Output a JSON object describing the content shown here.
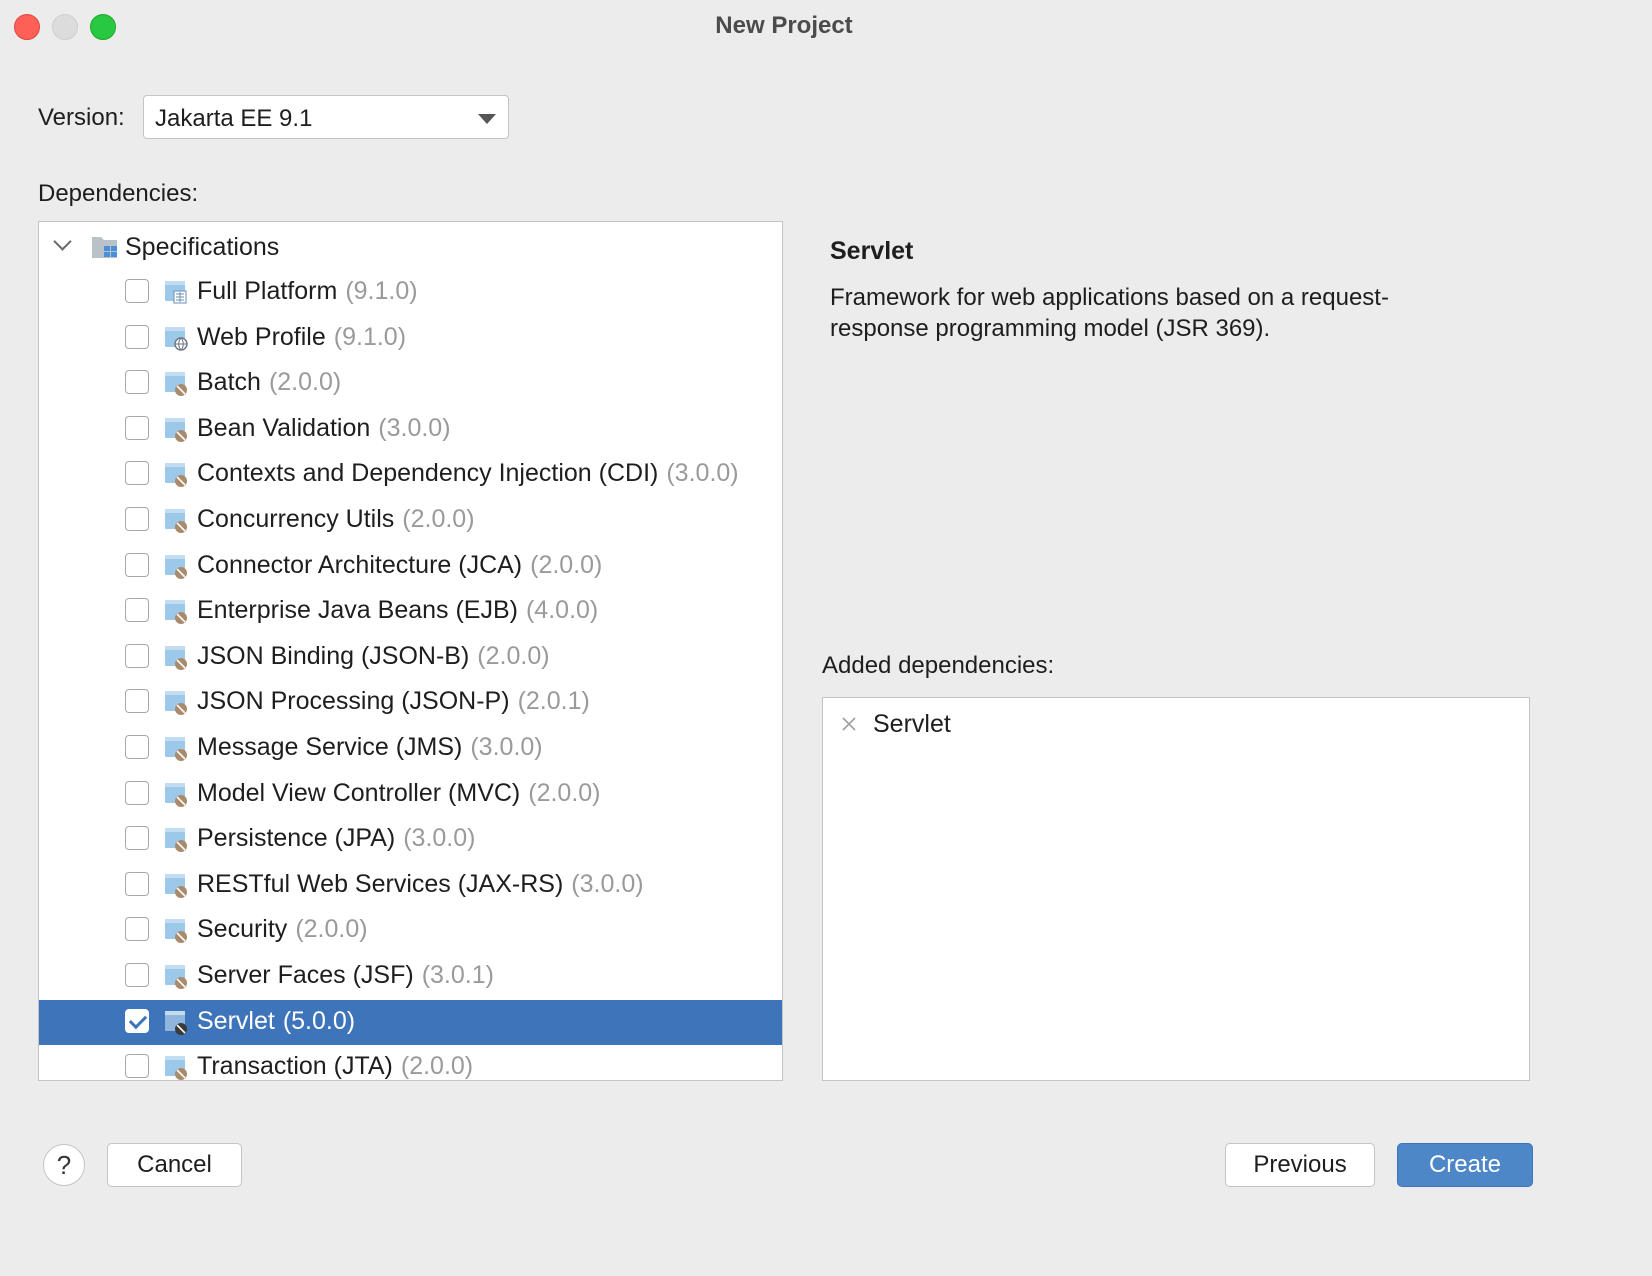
{
  "window": {
    "title": "New Project"
  },
  "version": {
    "label": "Version:",
    "value": "Jakarta EE 9.1"
  },
  "dependencies": {
    "label": "Dependencies:",
    "root": "Specifications",
    "items": [
      {
        "name": "Full Platform",
        "version": "(9.1.0)",
        "checked": false,
        "selected": false,
        "icon": "platform-icon"
      },
      {
        "name": "Web Profile",
        "version": "(9.1.0)",
        "checked": false,
        "selected": false,
        "icon": "web-profile-icon"
      },
      {
        "name": "Batch",
        "version": "(2.0.0)",
        "checked": false,
        "selected": false,
        "icon": "library-icon"
      },
      {
        "name": "Bean Validation",
        "version": "(3.0.0)",
        "checked": false,
        "selected": false,
        "icon": "library-icon"
      },
      {
        "name": "Contexts and Dependency Injection (CDI)",
        "version": "(3.0.0)",
        "checked": false,
        "selected": false,
        "icon": "library-icon"
      },
      {
        "name": "Concurrency Utils",
        "version": "(2.0.0)",
        "checked": false,
        "selected": false,
        "icon": "library-icon"
      },
      {
        "name": "Connector Architecture (JCA)",
        "version": "(2.0.0)",
        "checked": false,
        "selected": false,
        "icon": "library-icon"
      },
      {
        "name": "Enterprise Java Beans (EJB)",
        "version": "(4.0.0)",
        "checked": false,
        "selected": false,
        "icon": "library-icon"
      },
      {
        "name": "JSON Binding (JSON-B)",
        "version": "(2.0.0)",
        "checked": false,
        "selected": false,
        "icon": "library-icon"
      },
      {
        "name": "JSON Processing (JSON-P)",
        "version": "(2.0.1)",
        "checked": false,
        "selected": false,
        "icon": "library-icon"
      },
      {
        "name": "Message Service (JMS)",
        "version": "(3.0.0)",
        "checked": false,
        "selected": false,
        "icon": "library-icon"
      },
      {
        "name": "Model View Controller (MVC)",
        "version": "(2.0.0)",
        "checked": false,
        "selected": false,
        "icon": "library-icon"
      },
      {
        "name": "Persistence (JPA)",
        "version": "(3.0.0)",
        "checked": false,
        "selected": false,
        "icon": "library-icon"
      },
      {
        "name": "RESTful Web Services (JAX-RS)",
        "version": "(3.0.0)",
        "checked": false,
        "selected": false,
        "icon": "library-icon"
      },
      {
        "name": "Security",
        "version": "(2.0.0)",
        "checked": false,
        "selected": false,
        "icon": "library-icon"
      },
      {
        "name": "Server Faces (JSF)",
        "version": "(3.0.1)",
        "checked": false,
        "selected": false,
        "icon": "library-icon"
      },
      {
        "name": "Servlet",
        "version": "(5.0.0)",
        "checked": true,
        "selected": true,
        "icon": "library-icon"
      },
      {
        "name": "Transaction (JTA)",
        "version": "(2.0.0)",
        "checked": false,
        "selected": false,
        "icon": "library-icon"
      }
    ]
  },
  "detail": {
    "title": "Servlet",
    "description": "Framework for web applications based on a request-response programming model (JSR 369)."
  },
  "added": {
    "label": "Added dependencies:",
    "items": [
      {
        "name": "Servlet"
      }
    ]
  },
  "buttons": {
    "help": "?",
    "cancel": "Cancel",
    "previous": "Previous",
    "create": "Create"
  },
  "colors": {
    "selection": "#3d74ba",
    "primary_button": "#4e87c8",
    "window_bg": "#ececec",
    "version_text": "#9a9a9a"
  }
}
